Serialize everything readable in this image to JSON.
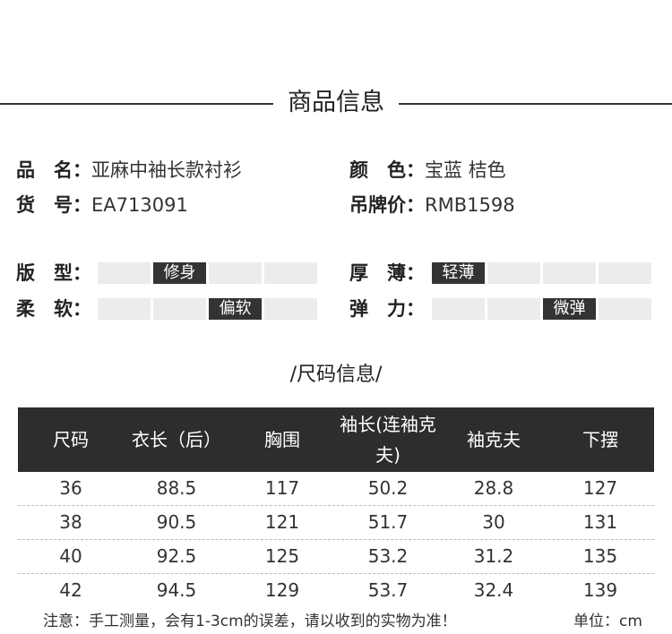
{
  "header": {
    "title": "商品信息"
  },
  "product": {
    "name_label": "品　名：",
    "name_value": "亚麻中袖长款衬衫",
    "color_label": "颜　色：",
    "color_value": "宝蓝 桔色",
    "sku_label": "货　号：",
    "sku_value": "EA713091",
    "price_label": "吊牌价：",
    "price_value": "RMB1598"
  },
  "attributes": {
    "fit": {
      "label": "版　型：",
      "selected": "修身",
      "selected_index": 1,
      "segments": 4
    },
    "thickness": {
      "label": "厚　薄：",
      "selected": "轻薄",
      "selected_index": 0,
      "segments": 4
    },
    "softness": {
      "label": "柔　软：",
      "selected": "偏软",
      "selected_index": 2,
      "segments": 4
    },
    "stretch": {
      "label": "弹　力：",
      "selected": "微弹",
      "selected_index": 2,
      "segments": 4
    }
  },
  "size_section": {
    "title": "/尺码信息/"
  },
  "size_table": {
    "headers": [
      "尺码",
      "衣长（后）",
      "胸围",
      "袖长(连袖克夫)",
      "袖克夫",
      "下摆"
    ],
    "rows": [
      [
        "36",
        "88.5",
        "117",
        "50.2",
        "28.8",
        "127"
      ],
      [
        "38",
        "90.5",
        "121",
        "51.7",
        "30",
        "131"
      ],
      [
        "40",
        "92.5",
        "125",
        "53.2",
        "31.2",
        "135"
      ],
      [
        "42",
        "94.5",
        "129",
        "53.7",
        "32.4",
        "139"
      ]
    ]
  },
  "footer": {
    "note": "注意：手工测量，会有1-3cm的误差，请以收到的实物为准！",
    "unit": "单位：cm"
  }
}
